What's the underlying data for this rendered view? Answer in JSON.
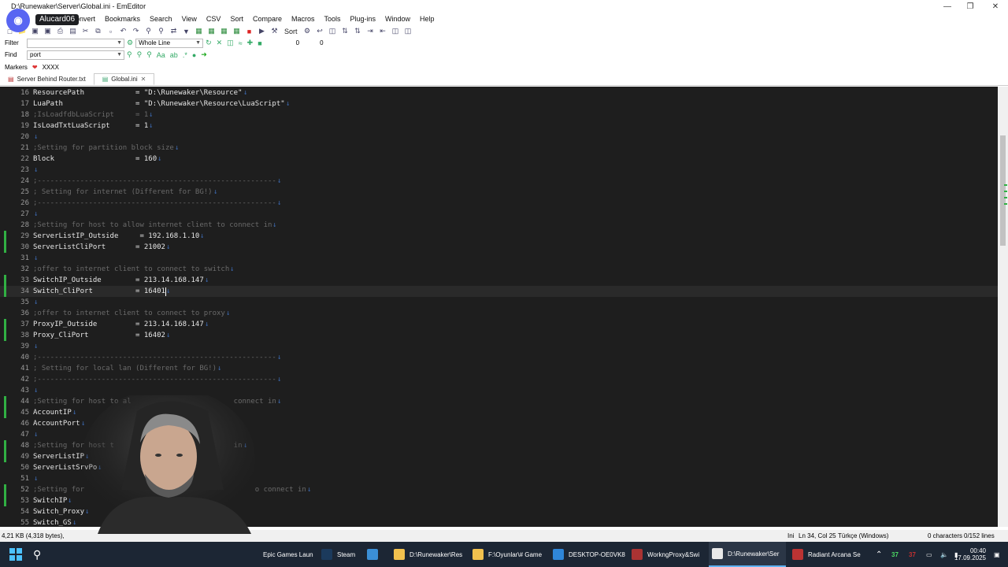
{
  "window": {
    "title": "D:\\Runewaker\\Server\\Global.ini - EmEditor"
  },
  "overlay": {
    "discord_user": "Alucard06"
  },
  "menu": [
    "onvert",
    "Bookmarks",
    "Search",
    "View",
    "CSV",
    "Sort",
    "Compare",
    "Macros",
    "Tools",
    "Plug-ins",
    "Window",
    "Help"
  ],
  "toolbar": {
    "sort_label": "Sort"
  },
  "filter": {
    "label": "Filter",
    "value": "",
    "mode": "Whole Line",
    "num1": "0",
    "num2": "0"
  },
  "find": {
    "label": "Find",
    "value": "port"
  },
  "markers": {
    "label": "Markers",
    "value": "XXXX"
  },
  "tabs": [
    {
      "label": "Server Behind Router.txt",
      "active": false
    },
    {
      "label": "Global.ini",
      "active": true
    }
  ],
  "lines": [
    {
      "n": "16",
      "text": "ResourcePath            = \"D:\\Runewaker\\Resource\"",
      "comment": false
    },
    {
      "n": "17",
      "text": "LuaPath                 = \"D:\\Runewaker\\Resource\\LuaScript\"",
      "comment": false
    },
    {
      "n": "18",
      "text": ";IsLoadfdbLuaScript     = 1",
      "comment": true
    },
    {
      "n": "19",
      "text": "IsLoadTxtLuaScript      = 1",
      "comment": false
    },
    {
      "n": "20",
      "text": "",
      "comment": false
    },
    {
      "n": "21",
      "text": ";Setting for partition block size",
      "comment": true
    },
    {
      "n": "22",
      "text": "Block                   = 160",
      "comment": false
    },
    {
      "n": "23",
      "text": "",
      "comment": false
    },
    {
      "n": "24",
      "text": ";--------------------------------------------------------",
      "comment": true
    },
    {
      "n": "25",
      "text": "; Setting for internet (Different for BG!)",
      "comment": true
    },
    {
      "n": "26",
      "text": ";--------------------------------------------------------",
      "comment": true
    },
    {
      "n": "27",
      "text": "",
      "comment": false
    },
    {
      "n": "28",
      "text": ";Setting for host to allow internet client to connect in",
      "comment": true
    },
    {
      "n": "29",
      "text": "ServerListIP_Outside     = 192.168.1.10",
      "comment": false
    },
    {
      "n": "30",
      "text": "ServerListCliPort       = 21002",
      "comment": false
    },
    {
      "n": "31",
      "text": "",
      "comment": false
    },
    {
      "n": "32",
      "text": ";offer to internet client to connect to switch",
      "comment": true
    },
    {
      "n": "33",
      "text": "SwitchIP_Outside        = 213.14.168.147",
      "comment": false
    },
    {
      "n": "34",
      "text": "Switch_CliPort          = 16401",
      "comment": false
    },
    {
      "n": "35",
      "text": "",
      "comment": false
    },
    {
      "n": "36",
      "text": ";offer to internet client to connect to proxy",
      "comment": true
    },
    {
      "n": "37",
      "text": "ProxyIP_Outside         = 213.14.168.147",
      "comment": false
    },
    {
      "n": "38",
      "text": "Proxy_CliPort           = 16402",
      "comment": false
    },
    {
      "n": "39",
      "text": "",
      "comment": false
    },
    {
      "n": "40",
      "text": ";--------------------------------------------------------",
      "comment": true
    },
    {
      "n": "41",
      "text": "; Setting for local lan (Different for BG!)",
      "comment": true
    },
    {
      "n": "42",
      "text": ";--------------------------------------------------------",
      "comment": true
    },
    {
      "n": "43",
      "text": "",
      "comment": false
    },
    {
      "n": "44",
      "text": ";Setting for host to al                        connect in",
      "comment": true
    },
    {
      "n": "45",
      "text": "AccountIP",
      "comment": false
    },
    {
      "n": "46",
      "text": "AccountPort",
      "comment": false
    },
    {
      "n": "47",
      "text": "",
      "comment": false
    },
    {
      "n": "48",
      "text": ";Setting for host t                            in",
      "comment": true
    },
    {
      "n": "49",
      "text": "ServerListIP",
      "comment": false
    },
    {
      "n": "50",
      "text": "ServerListSrvPo",
      "comment": false
    },
    {
      "n": "51",
      "text": "",
      "comment": false
    },
    {
      "n": "52",
      "text": ";Setting for                                        o connect in",
      "comment": true
    },
    {
      "n": "53",
      "text": "SwitchIP",
      "comment": false
    },
    {
      "n": "54",
      "text": "Switch_Proxy",
      "comment": false
    },
    {
      "n": "55",
      "text": "Switch_GS",
      "comment": false
    }
  ],
  "status": {
    "size": "4,21 KB (4,318 bytes),",
    "type": "Ini",
    "position": "Ln 34, Col 25",
    "encoding": "Türkçe (Windows)",
    "selection": "0 characters",
    "lines": "0/152 lines"
  },
  "taskbar": {
    "items": [
      "Epic Games Laun",
      "Steam",
      "D:\\Runewaker\\Res",
      "F:\\Oyunlar\\# Game",
      "DESKTOP-OE0VK8",
      "WorkngProxy&Swi",
      "D:\\Runewaker\\Ser",
      "Radiant Arcana Se"
    ],
    "tray_num1": "37",
    "tray_num2": "37",
    "time": "00:40",
    "date": "17.09.2025"
  },
  "colors": {
    "editor_bg": "#1e1e1e",
    "comment": "#6a6a6a",
    "text": "#e6e6e6",
    "eol_arrow": "#3d6bb5",
    "changed_marker": "#31b043",
    "taskbar_bg": "#1c2634"
  }
}
